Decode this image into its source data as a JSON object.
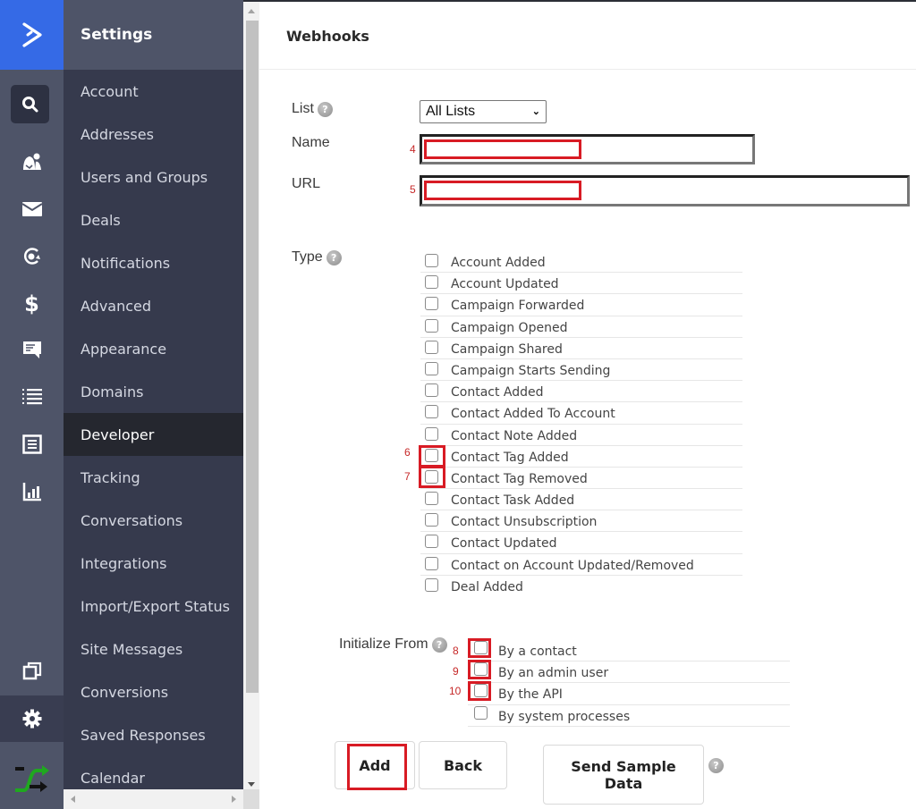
{
  "rail": {
    "brand_icon": "activecampaign-chevron-logo",
    "icons": [
      "search-icon",
      "contacts-icon",
      "envelope-icon",
      "automation-icon",
      "dollar-icon",
      "conversations-icon",
      "lists-icon",
      "forms-icon",
      "reports-icon",
      "pages-icon",
      "gear-icon",
      "integration-shuffle-icon"
    ],
    "brand_color": "#356AE6"
  },
  "menu": {
    "title": "Settings",
    "items": [
      {
        "label": "Account"
      },
      {
        "label": "Addresses"
      },
      {
        "label": "Users and Groups"
      },
      {
        "label": "Deals"
      },
      {
        "label": "Notifications"
      },
      {
        "label": "Advanced"
      },
      {
        "label": "Appearance"
      },
      {
        "label": "Domains"
      },
      {
        "label": "Developer",
        "active": true
      },
      {
        "label": "Tracking"
      },
      {
        "label": "Conversations"
      },
      {
        "label": "Integrations"
      },
      {
        "label": "Import/Export Status"
      },
      {
        "label": "Site Messages"
      },
      {
        "label": "Conversions"
      },
      {
        "label": "Saved Responses"
      },
      {
        "label": "Calendar"
      }
    ]
  },
  "page": {
    "title": "Webhooks"
  },
  "form": {
    "list_label": "List",
    "list_value": "All Lists",
    "name_label": "Name",
    "name_value": "",
    "url_label": "URL",
    "url_value": "",
    "type_label": "Type",
    "types": [
      "Account Added",
      "Account Updated",
      "Campaign Forwarded",
      "Campaign Opened",
      "Campaign Shared",
      "Campaign Starts Sending",
      "Contact Added",
      "Contact Added To Account",
      "Contact Note Added",
      "Contact Tag Added",
      "Contact Tag Removed",
      "Contact Task Added",
      "Contact Unsubscription",
      "Contact Updated",
      "Contact on Account Updated/Removed",
      "Deal Added"
    ],
    "init_label": "Initialize From",
    "init_options": [
      "By a contact",
      "By an admin user",
      "By the API",
      "By system processes"
    ]
  },
  "buttons": {
    "add": "Add",
    "back": "Back",
    "send_sample": "Send Sample Data"
  },
  "annotations": {
    "name_field": "4",
    "url_field": "5",
    "tag_added": "6",
    "tag_removed": "7",
    "by_contact": "8",
    "by_admin": "9",
    "by_api": "10",
    "highlight_color": "#D81B24"
  },
  "help_glyph": "?"
}
